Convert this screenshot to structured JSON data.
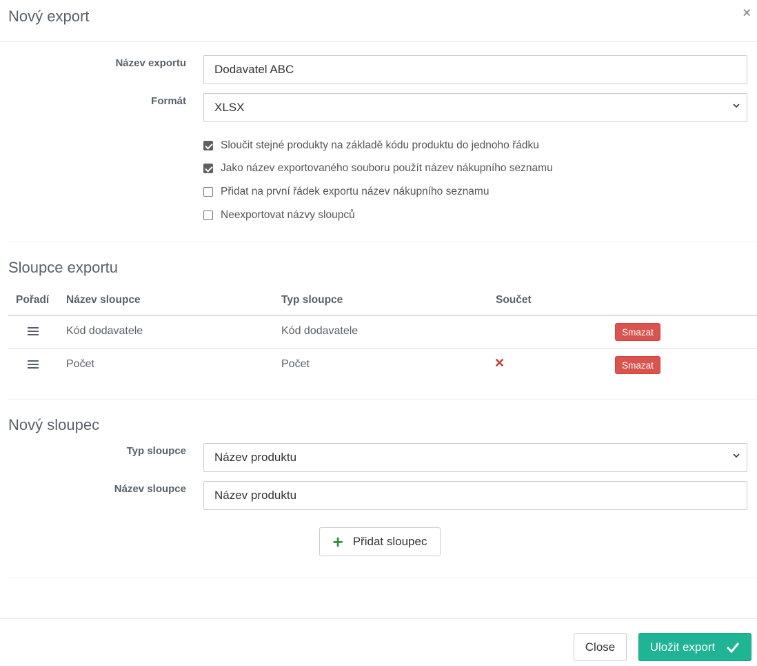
{
  "modal": {
    "title": "Nový export",
    "close_icon": "×"
  },
  "form": {
    "export_name_label": "Název exportu",
    "export_name_value": "Dodavatel ABC",
    "format_label": "Formát",
    "format_value": "XLSX",
    "options": [
      {
        "label": "Sloučit stejné produkty na základě kódu produktu do jednoho řádku",
        "checked": true
      },
      {
        "label": "Jako název exportovaného souboru použít název nákupního seznamu",
        "checked": true
      },
      {
        "label": "Přidat na první řádek exportu název nákupního seznamu",
        "checked": false
      },
      {
        "label": "Neexportovat názvy sloupců",
        "checked": false
      }
    ]
  },
  "columns_section": {
    "title": "Sloupce exportu",
    "headers": {
      "order": "Pořadí",
      "column_name": "Název sloupce",
      "column_type": "Typ sloupce",
      "sum": "Součet"
    },
    "rows": [
      {
        "name": "Kód dodavatele",
        "type": "Kód dodavatele",
        "sum": "",
        "delete_label": "Smazat"
      },
      {
        "name": "Počet",
        "type": "Počet",
        "sum": "✕",
        "delete_label": "Smazat"
      }
    ]
  },
  "new_column": {
    "title": "Nový sloupec",
    "type_label": "Typ sloupce",
    "type_value": "Název produktu",
    "name_label": "Název sloupce",
    "name_value": "Název produktu",
    "add_button": "Přidat sloupec"
  },
  "footer": {
    "close_button": "Close",
    "save_button": "Uložit export"
  },
  "colors": {
    "delete": "#d9534f",
    "save": "#1fb594",
    "sum_x": "#c0392b",
    "add_plus": "#3c8d3c"
  }
}
